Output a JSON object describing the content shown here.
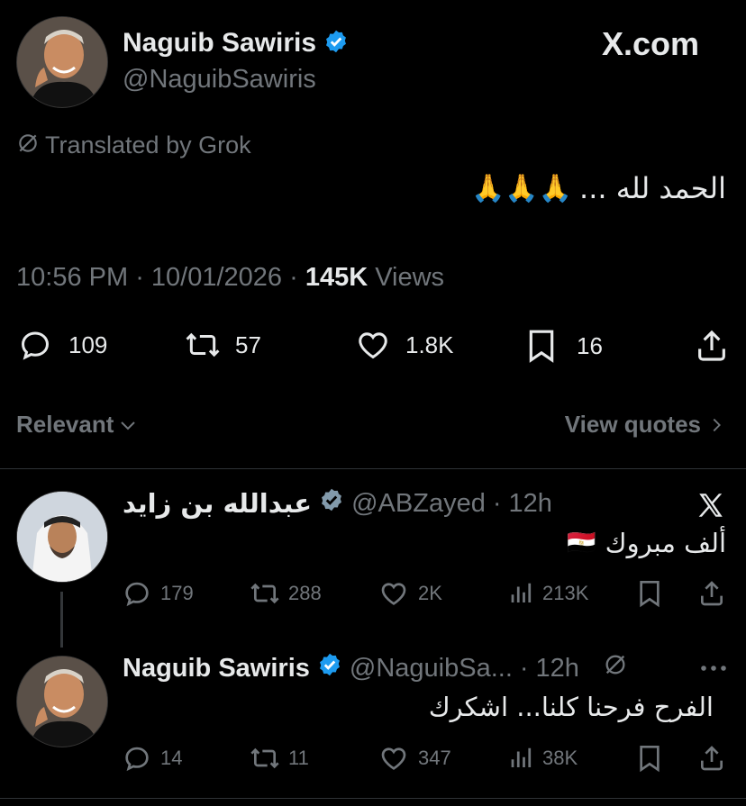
{
  "main_tweet": {
    "author_name": "Naguib Sawiris",
    "handle": "@NaguibSawiris",
    "brand": "X.com",
    "translated_by": "Translated by Grok",
    "text": "الحمد لله ...",
    "emojis": "🙏🙏🙏",
    "time": "10:56 PM",
    "date": "10/01/2026",
    "views_count": "145K",
    "views_label": "Views",
    "replies": "109",
    "reposts": "57",
    "likes": "1.8K",
    "bookmarks": "16"
  },
  "filter": {
    "sort_label": "Relevant",
    "view_quotes": "View quotes"
  },
  "replies": [
    {
      "author_name": "عبدالله بن زايد",
      "handle": "@ABZayed",
      "time": "12h",
      "text": "ألف مبروك",
      "flag": "🇪🇬",
      "replies": "179",
      "reposts": "288",
      "likes": "2K",
      "views": "213K"
    },
    {
      "author_name": "Naguib Sawiris",
      "handle": "@NaguibSa...",
      "time": "12h",
      "text": "الفرح فرحنا كلنا... اشكرك",
      "replies": "14",
      "reposts": "11",
      "likes": "347",
      "views": "38K"
    }
  ],
  "colors": {
    "background": "#000000",
    "text": "#e7e9ea",
    "muted": "#71767b",
    "verified": "#1d9bf0"
  }
}
